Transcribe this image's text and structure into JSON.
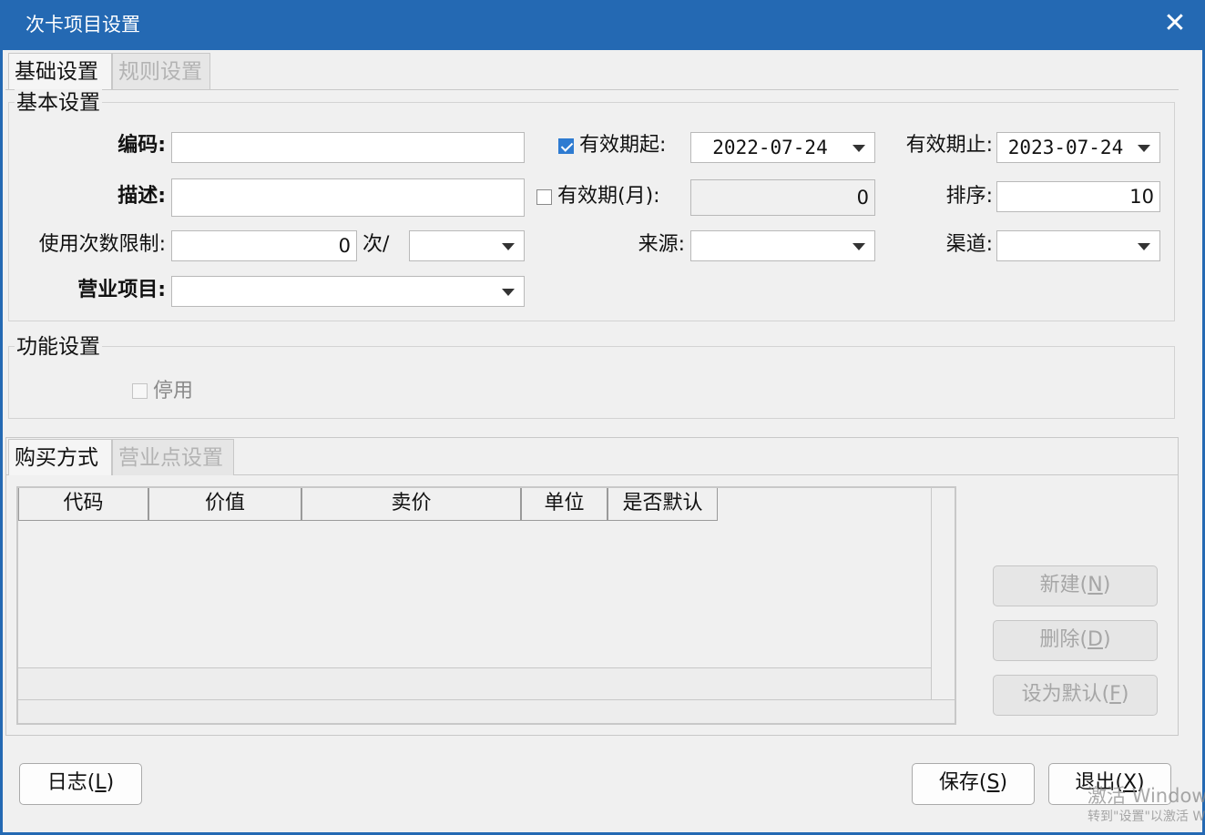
{
  "window": {
    "title": "次卡项目设置",
    "close_icon": "close-icon"
  },
  "top_tabs": [
    {
      "label": "基础设置",
      "active": true
    },
    {
      "label": "规则设置",
      "active": false
    }
  ],
  "basic_group": {
    "title": "基本设置",
    "code": {
      "label": "编码:",
      "value": ""
    },
    "desc": {
      "label": "描述:",
      "value": ""
    },
    "usage_limit": {
      "label": "使用次数限制:",
      "value": "0",
      "unit": "次/",
      "period_value": ""
    },
    "business_item": {
      "label": "营业项目:",
      "value": ""
    },
    "valid_from": {
      "label": "有效期起:",
      "checked": true,
      "value": "2022-07-24"
    },
    "valid_months": {
      "label": "有效期(月):",
      "checked": false,
      "value": "0"
    },
    "source": {
      "label": "来源:",
      "value": ""
    },
    "valid_to": {
      "label": "有效期止:",
      "value": "2023-07-24"
    },
    "sort": {
      "label": "排序:",
      "value": "10"
    },
    "channel": {
      "label": "渠道:",
      "value": ""
    }
  },
  "function_group": {
    "title": "功能设置",
    "disable": {
      "label": "停用",
      "checked": false
    }
  },
  "lower_tabs": [
    {
      "label": "购买方式",
      "active": true
    },
    {
      "label": "营业点设置",
      "active": false
    }
  ],
  "table": {
    "columns": [
      "代码",
      "价值",
      "卖价",
      "单位",
      "是否默认"
    ],
    "rows": []
  },
  "side_buttons": {
    "new": {
      "text": "新建",
      "key": "N"
    },
    "delete": {
      "text": "删除",
      "key": "D"
    },
    "set_default": {
      "text": "设为默认",
      "key": "F"
    }
  },
  "footer": {
    "log": {
      "text": "日志",
      "key": "L"
    },
    "save": {
      "text": "保存",
      "key": "S"
    },
    "exit": {
      "text": "退出",
      "key": "X"
    }
  },
  "watermark": {
    "line1": "激活 Windows",
    "line2": "转到\"设置\"以激活 W"
  },
  "colors": {
    "titlebar": "#2469b3",
    "checkbox_checked": "#2e7bd1"
  }
}
